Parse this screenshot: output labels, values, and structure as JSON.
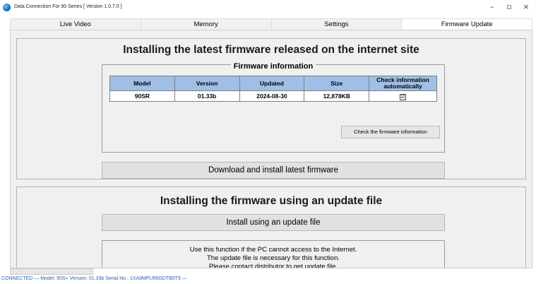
{
  "window": {
    "title": "Data Connection For 90 Series [ Version 1.0.7.0 ]",
    "minimize_glyph": "–",
    "maximize_glyph": "▫",
    "close_glyph": "×"
  },
  "tabs": [
    {
      "label": "Live Video"
    },
    {
      "label": "Memory"
    },
    {
      "label": "Settings"
    },
    {
      "label": "Firmware Update",
      "active": true
    }
  ],
  "internet_section": {
    "title": "Installing the latest firmware released on the internet site",
    "group_legend": "Firmware information",
    "table": {
      "headers": [
        "Model",
        "Version",
        "Updated",
        "Size",
        "Check information automatically"
      ],
      "rows": [
        {
          "model": "90SR",
          "version": "01.33b",
          "updated": "2024-08-30",
          "size": "12,878KB",
          "auto_check": "☑"
        }
      ]
    },
    "check_button_label": "Check the firmware information",
    "download_button_label": "Download and install latest firmware"
  },
  "file_section": {
    "title": "Installing the firmware using an update file",
    "install_button_label": "Install using an update file",
    "info_lines": [
      "Use this function if the PC cannot access to the Internet.",
      "The update file is necessary for this function.",
      "Please contact distributor to get update file."
    ]
  },
  "status_bar": {
    "text": "CONNECTED  —  Model: 90S+  Version: 01.33b  Serial No.: 1XA9MPLR6GDTB5T9  —"
  },
  "colors": {
    "table_header": "#9fbfe6",
    "panel_bg": "#f0f0f0",
    "status_text": "#2b5fb8"
  },
  "icons": {
    "app": "app-globe-icon"
  }
}
